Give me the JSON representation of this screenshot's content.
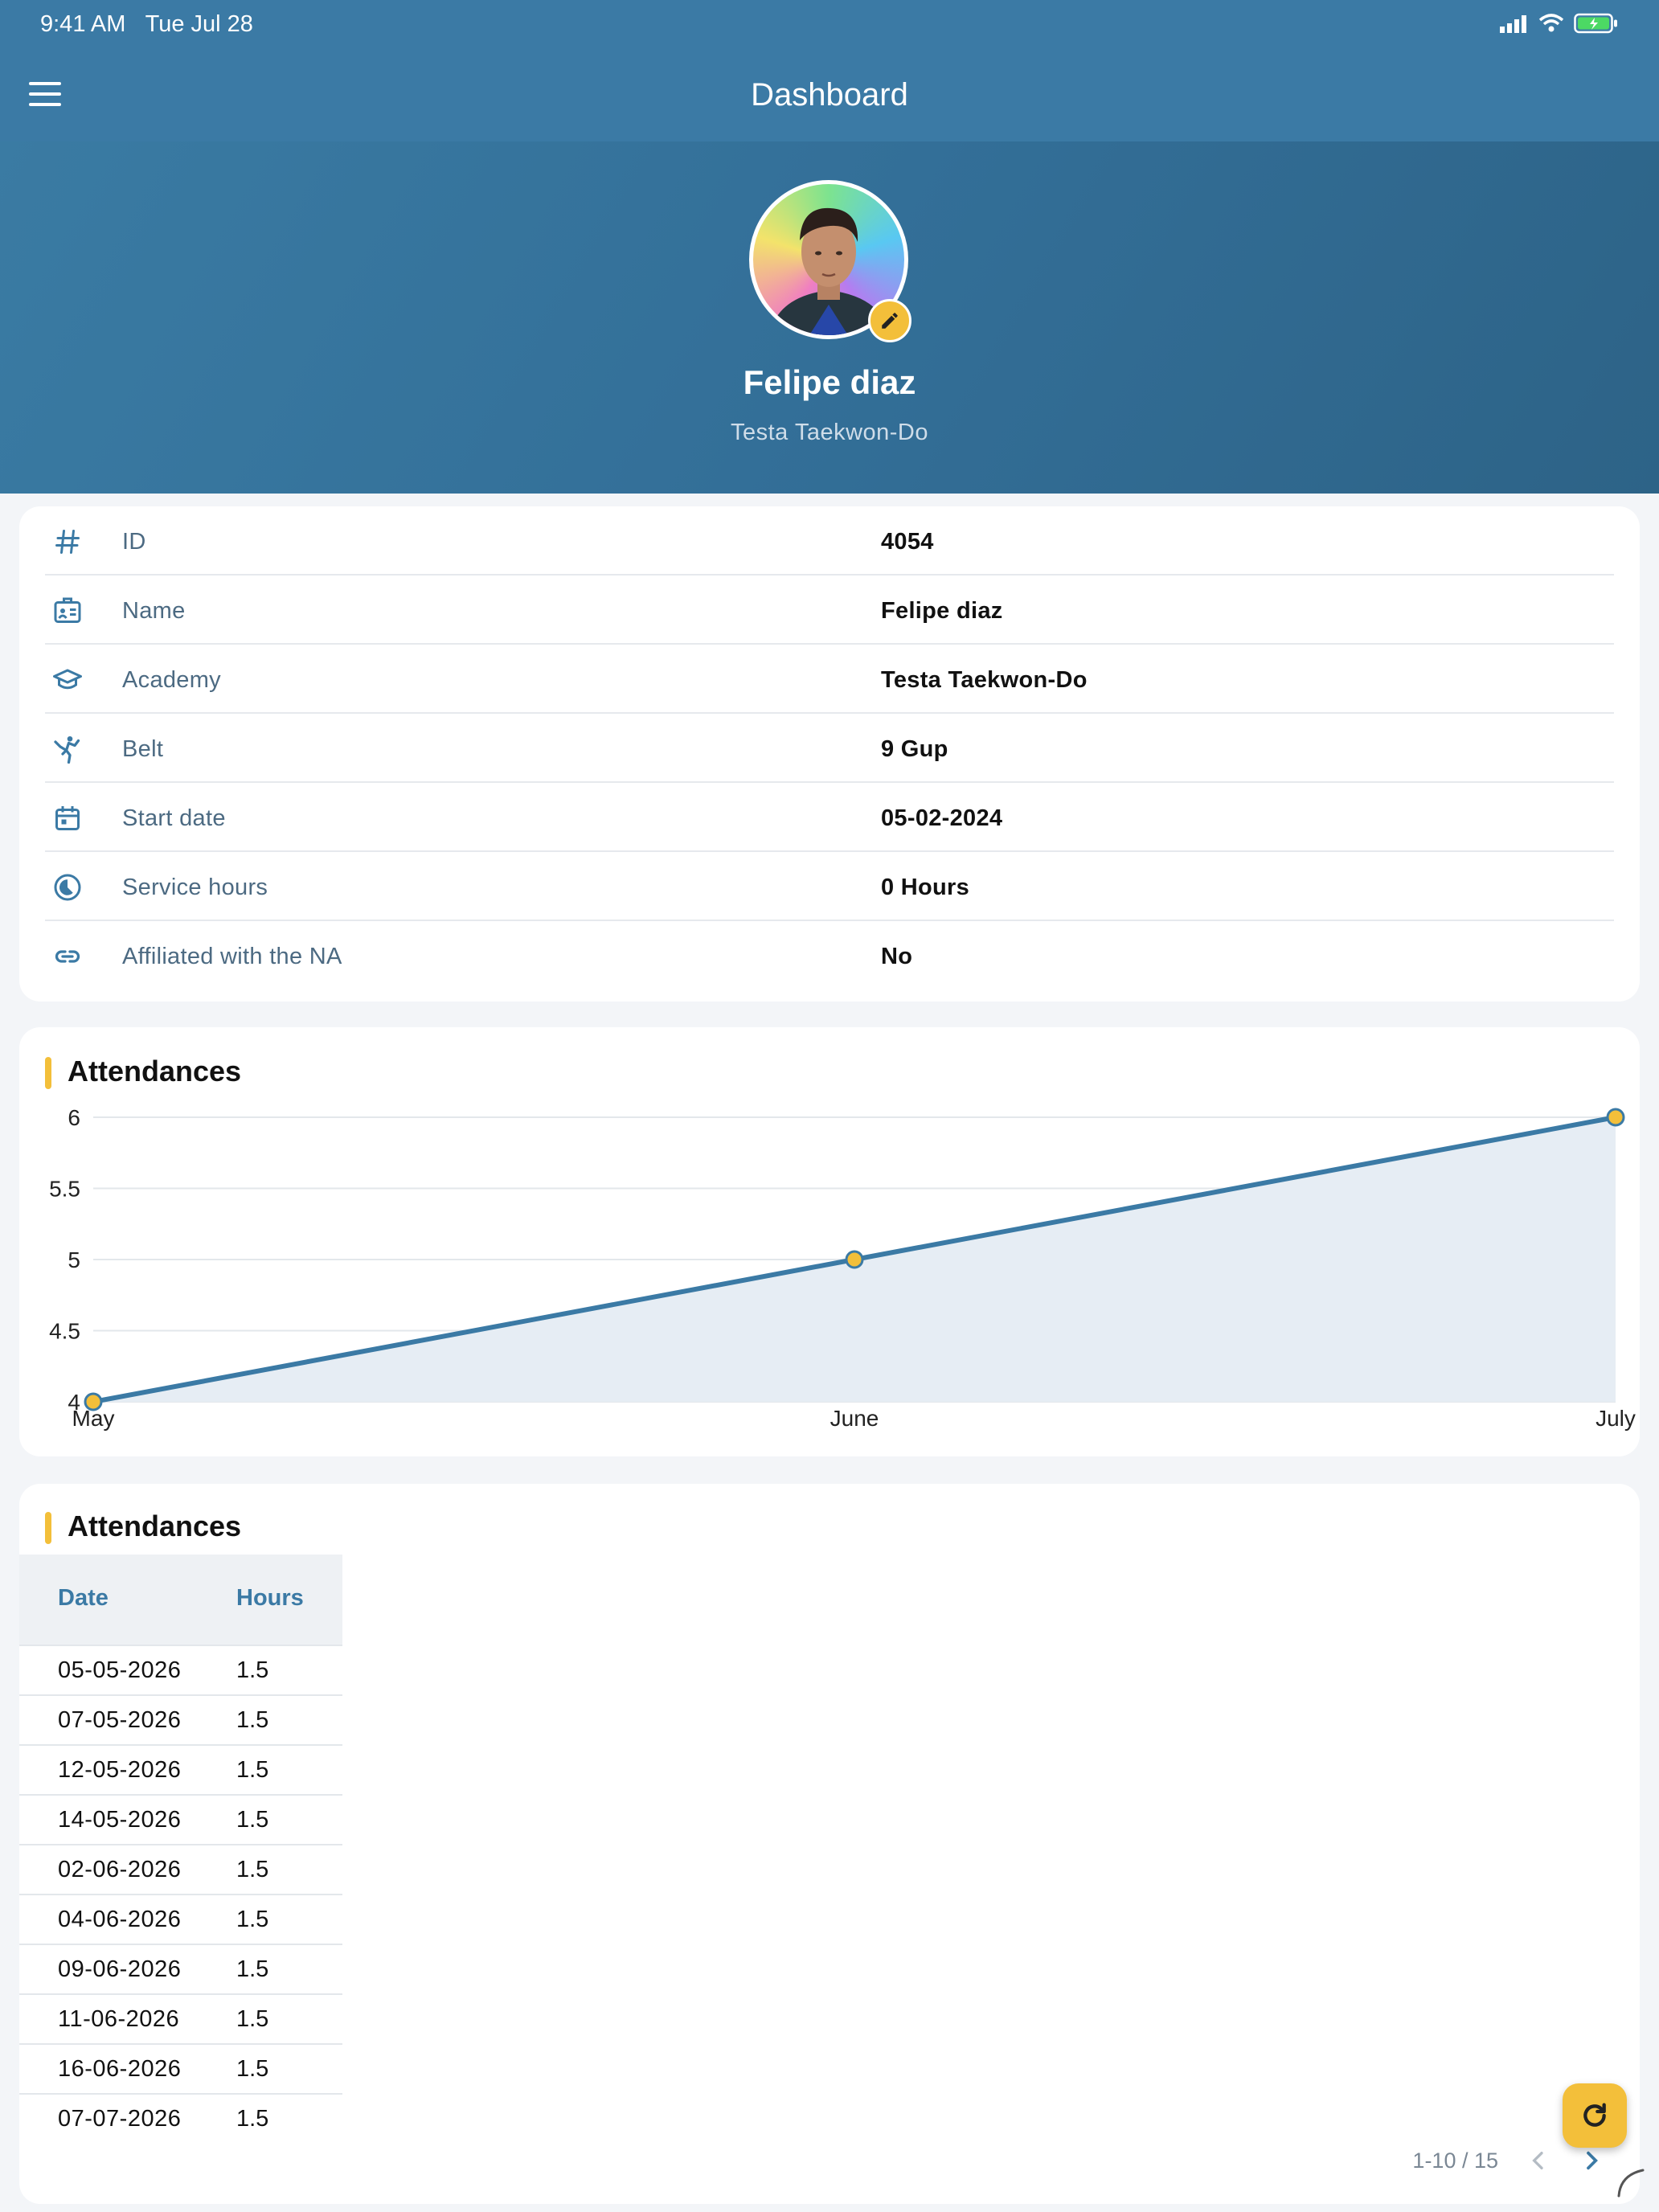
{
  "status_bar": {
    "time": "9:41 AM",
    "date": "Tue Jul 28"
  },
  "app_bar": {
    "title": "Dashboard",
    "menu_icon": "hamburger-menu-icon"
  },
  "profile": {
    "name": "Felipe diaz",
    "academy": "Testa Taekwon-Do",
    "edit_icon": "pencil-icon"
  },
  "info": [
    {
      "icon": "hash-icon",
      "label": "ID",
      "value": "4054"
    },
    {
      "icon": "id-card-icon",
      "label": "Name",
      "value": "Felipe diaz"
    },
    {
      "icon": "graduation-cap-icon",
      "label": "Academy",
      "value": "Testa Taekwon-Do"
    },
    {
      "icon": "martial-arts-kick-icon",
      "label": "Belt",
      "value": "9 Gup"
    },
    {
      "icon": "calendar-icon",
      "label": "Start date",
      "value": "05-02-2024"
    },
    {
      "icon": "clock-pie-icon",
      "label": "Service hours",
      "value": "0 Hours"
    },
    {
      "icon": "link-icon",
      "label": "Affiliated with the NA",
      "value": "No"
    }
  ],
  "chart_section": {
    "title": "Attendances"
  },
  "chart_data": {
    "type": "area",
    "categories": [
      "May",
      "June",
      "July"
    ],
    "values": [
      4,
      5,
      6
    ],
    "ylim": [
      4,
      6
    ],
    "yticks": [
      "4",
      "4.5",
      "5",
      "5.5",
      "6"
    ],
    "grid": true,
    "colors": {
      "line": "#3b7aa5",
      "fill": "#e6edf4",
      "point": "#f3bf3a"
    }
  },
  "table_section": {
    "title": "Attendances",
    "columns": [
      "Date",
      "Hours"
    ],
    "rows": [
      [
        "05-05-2026",
        "1.5"
      ],
      [
        "07-05-2026",
        "1.5"
      ],
      [
        "12-05-2026",
        "1.5"
      ],
      [
        "14-05-2026",
        "1.5"
      ],
      [
        "02-06-2026",
        "1.5"
      ],
      [
        "04-06-2026",
        "1.5"
      ],
      [
        "09-06-2026",
        "1.5"
      ],
      [
        "11-06-2026",
        "1.5"
      ],
      [
        "16-06-2026",
        "1.5"
      ],
      [
        "07-07-2026",
        "1.5"
      ]
    ],
    "pagination": "1-10 / 15"
  },
  "fab": {
    "icon": "refresh-icon"
  },
  "colors": {
    "primary": "#3b7aa5",
    "accent": "#f3bf3a"
  }
}
